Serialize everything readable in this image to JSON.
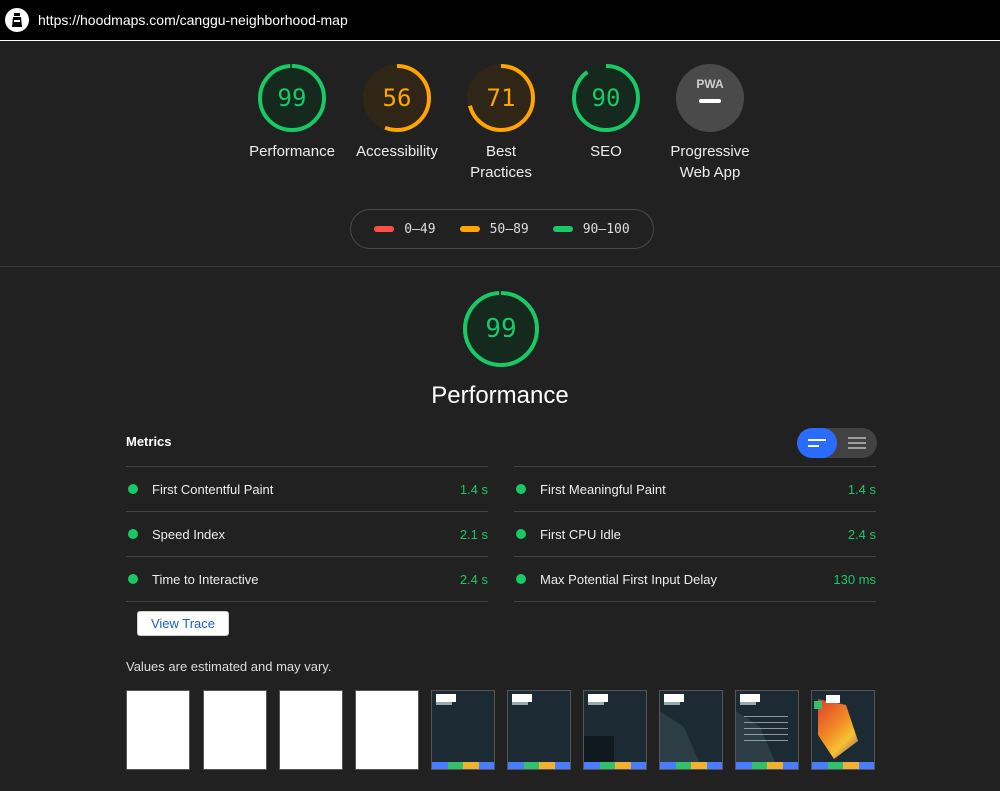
{
  "header": {
    "url": "https://hoodmaps.com/canggu-neighborhood-map"
  },
  "colors": {
    "good": "#18c965",
    "average": "#ffa400",
    "fail": "#ff4e42",
    "neutral": "#555555",
    "accent": "#2a6cff"
  },
  "categories": [
    {
      "label_lines": [
        "Performance"
      ],
      "score": "99",
      "fraction": 0.99,
      "color": "good"
    },
    {
      "label_lines": [
        "Accessibility"
      ],
      "score": "56",
      "fraction": 0.56,
      "color": "average"
    },
    {
      "label_lines": [
        "Best",
        "Practices"
      ],
      "score": "71",
      "fraction": 0.71,
      "color": "average"
    },
    {
      "label_lines": [
        "SEO"
      ],
      "score": "90",
      "fraction": 0.9,
      "color": "good"
    },
    {
      "label_lines": [
        "Progressive",
        "Web App"
      ],
      "badge_text": "PWA",
      "color": "neutral"
    }
  ],
  "legend": [
    {
      "range": "0–49",
      "color": "fail"
    },
    {
      "range": "50–89",
      "color": "average"
    },
    {
      "range": "90–100",
      "color": "good"
    }
  ],
  "performance": {
    "score": "99",
    "fraction": 0.99,
    "title": "Performance",
    "metrics_heading": "Metrics",
    "metrics_left": [
      {
        "name": "First Contentful Paint",
        "value": "1.4 s"
      },
      {
        "name": "Speed Index",
        "value": "2.1 s"
      },
      {
        "name": "Time to Interactive",
        "value": "2.4 s"
      }
    ],
    "metrics_right": [
      {
        "name": "First Meaningful Paint",
        "value": "1.4 s"
      },
      {
        "name": "First CPU Idle",
        "value": "2.4 s"
      },
      {
        "name": "Max Potential First Input Delay",
        "value": "130 ms"
      }
    ],
    "view_trace_label": "View Trace",
    "estimate_note": "Values are estimated and may vary."
  }
}
